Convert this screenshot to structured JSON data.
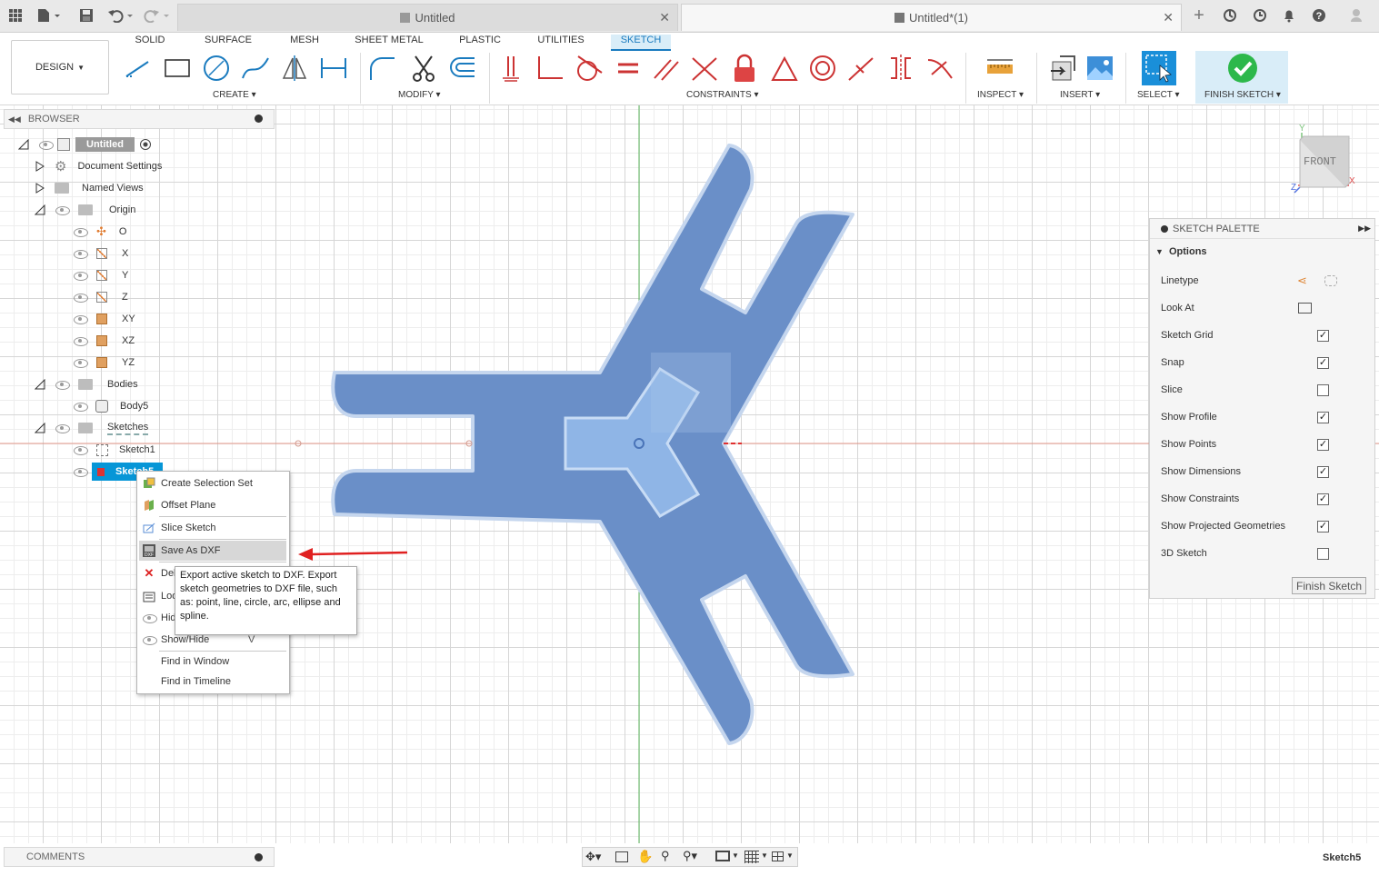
{
  "tabs": {
    "doc1": "Untitled",
    "doc2": "Untitled*(1)"
  },
  "ribbon": {
    "workspace": "DESIGN",
    "tabs": [
      "SOLID",
      "SURFACE",
      "MESH",
      "SHEET METAL",
      "PLASTIC",
      "UTILITIES",
      "SKETCH"
    ],
    "active_tab": "SKETCH",
    "groups": {
      "create": "CREATE",
      "modify": "MODIFY",
      "constraints": "CONSTRAINTS",
      "inspect": "INSPECT",
      "insert": "INSERT",
      "select": "SELECT",
      "finish": "FINISH SKETCH"
    },
    "accent": "#1a7bbf",
    "finish_color": "#2db84b"
  },
  "browser": {
    "title": "BROWSER",
    "root": "Untitled",
    "items": {
      "doc_settings": "Document Settings",
      "named_views": "Named Views",
      "origin": "Origin",
      "o": "O",
      "x": "X",
      "y": "Y",
      "z": "Z",
      "xy": "XY",
      "xz": "XZ",
      "yz": "YZ",
      "bodies": "Bodies",
      "body5": "Body5",
      "sketches": "Sketches",
      "sketch1": "Sketch1",
      "sketch5": "Sketch5"
    }
  },
  "context_menu": {
    "create_selection_set": "Create Selection Set",
    "offset_plane": "Offset Plane",
    "slice_sketch": "Slice Sketch",
    "save_as_dxf": "Save As DXF",
    "delete": "Del",
    "look_at": "Loo",
    "hide": "Hid",
    "show_hide": "Show/Hide",
    "show_hide_shortcut": "V",
    "find_in_window": "Find in Window",
    "find_in_timeline": "Find in Timeline"
  },
  "tooltip": "Export active sketch to DXF. Export sketch geometries to DXF file, such as: point, line, circle, arc, ellipse and spline.",
  "viewcube": {
    "face": "FRONT",
    "axis_x": "X",
    "axis_y": "Y",
    "axis_z": "Z"
  },
  "sketch_palette": {
    "title": "SKETCH PALETTE",
    "section": "Options",
    "rows": [
      {
        "label": "Linetype"
      },
      {
        "label": "Look At"
      },
      {
        "label": "Sketch Grid",
        "checked": true
      },
      {
        "label": "Snap",
        "checked": true
      },
      {
        "label": "Slice",
        "checked": false
      },
      {
        "label": "Show Profile",
        "checked": true
      },
      {
        "label": "Show Points",
        "checked": true
      },
      {
        "label": "Show Dimensions",
        "checked": true
      },
      {
        "label": "Show Constraints",
        "checked": true
      },
      {
        "label": "Show Projected Geometries",
        "checked": true
      },
      {
        "label": "3D Sketch",
        "checked": false
      }
    ],
    "finish_button": "Finish Sketch"
  },
  "comments": {
    "title": "COMMENTS"
  },
  "status": {
    "active_sketch": "Sketch5"
  },
  "colors": {
    "sketch_fill": "#6a8fc8",
    "sketch_outline": "#c5d6ee",
    "selection_blue": "#0696d7",
    "arrow_red": "#e02020"
  }
}
